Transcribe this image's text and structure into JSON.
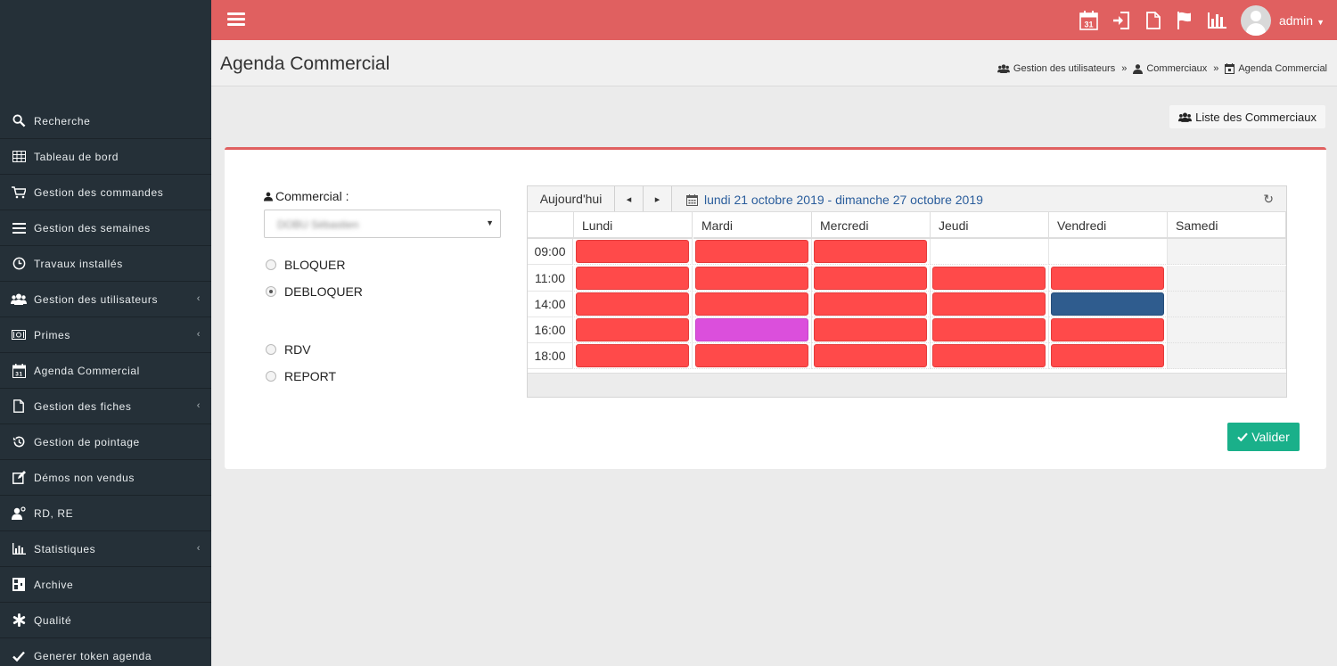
{
  "sidebar": {
    "items": [
      {
        "label": "Recherche",
        "icon": "search-icon",
        "chevron": false
      },
      {
        "label": "Tableau de bord",
        "icon": "table-icon",
        "chevron": false
      },
      {
        "label": "Gestion des commandes",
        "icon": "cart-icon",
        "chevron": false
      },
      {
        "label": "Gestion des semaines",
        "icon": "list-icon",
        "chevron": false
      },
      {
        "label": "Travaux installés",
        "icon": "clock-icon",
        "chevron": false
      },
      {
        "label": "Gestion des utilisateurs",
        "icon": "users-icon",
        "chevron": true
      },
      {
        "label": "Primes",
        "icon": "money-icon",
        "chevron": true
      },
      {
        "label": "Agenda Commercial",
        "icon": "calendar-icon",
        "chevron": false
      },
      {
        "label": "Gestion des fiches",
        "icon": "file-icon",
        "chevron": true
      },
      {
        "label": "Gestion de pointage",
        "icon": "history-icon",
        "chevron": false
      },
      {
        "label": "Démos non vendus",
        "icon": "edit-icon",
        "chevron": false
      },
      {
        "label": "RD, RE",
        "icon": "user-gear-icon",
        "chevron": false
      },
      {
        "label": "Statistiques",
        "icon": "bar-chart-icon",
        "chevron": true
      },
      {
        "label": "Archive",
        "icon": "archive-icon",
        "chevron": false
      },
      {
        "label": "Qualité",
        "icon": "asterisk-icon",
        "chevron": false
      },
      {
        "label": "Generer token agenda",
        "icon": "check-icon",
        "chevron": false
      }
    ]
  },
  "topbar": {
    "user": "admin",
    "calendar_day": "31",
    "icons": [
      "calendar-icon",
      "sign-in-icon",
      "file-icon",
      "flag-icon",
      "bar-chart-icon"
    ]
  },
  "header": {
    "title": "Agenda Commercial",
    "breadcrumb": [
      "Gestion des utilisateurs",
      "Commerciaux",
      "Agenda Commercial"
    ],
    "separator": "»"
  },
  "list_button": "Liste des Commerciaux",
  "form": {
    "commercial_label": "Commercial :",
    "commercial_value": "DOBU Sébastien",
    "block_options": [
      {
        "label": "BLOQUER",
        "checked": false
      },
      {
        "label": "DEBLOQUER",
        "checked": true
      }
    ],
    "type_options": [
      {
        "label": "RDV",
        "checked": false
      },
      {
        "label": "REPORT",
        "checked": false
      }
    ],
    "submit": "Valider"
  },
  "calendar": {
    "today_button": "Aujourd'hui",
    "prev": "◂",
    "next": "▸",
    "range": "lundi 21 octobre 2019 - dimanche 27 octobre 2019",
    "refresh": "↻",
    "days": [
      "Lundi",
      "Mardi",
      "Mercredi",
      "Jeudi",
      "Vendredi",
      "Samedi"
    ],
    "times": [
      "09:00",
      "11:00",
      "14:00",
      "16:00",
      "18:00"
    ],
    "events": [
      [
        "red",
        "red",
        "red",
        null,
        null
      ],
      [
        "red",
        "red",
        "red",
        "red",
        "red"
      ],
      [
        "red",
        "red",
        "red",
        "red",
        "blue"
      ],
      [
        "red",
        "purple",
        "red",
        "red",
        "red"
      ],
      [
        "red",
        "red",
        "red",
        "red",
        "red"
      ]
    ],
    "colors": {
      "red": "#ff4a4a",
      "purple": "#db4fdc",
      "blue": "#2f5c8e"
    }
  },
  "colors": {
    "sidebar_bg": "#253038",
    "topbar_bg": "#e06060",
    "accent_green": "#1ab08a",
    "link_blue": "#2a5d9c"
  }
}
